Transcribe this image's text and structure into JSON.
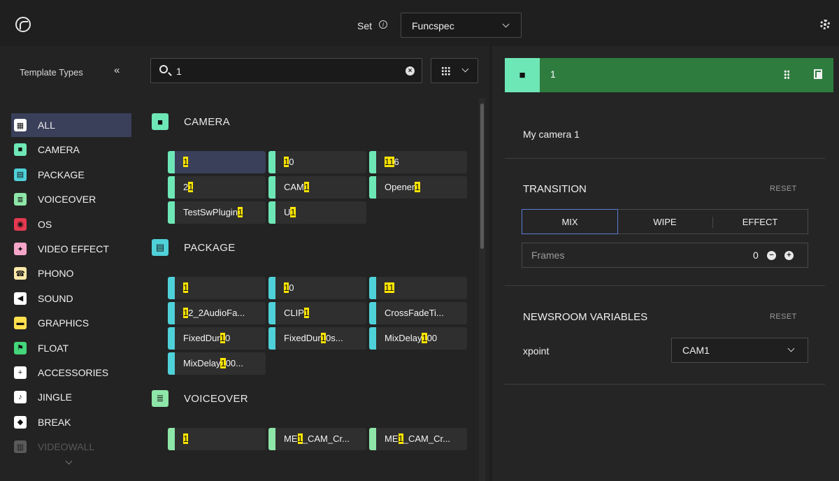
{
  "header": {
    "set_label": "Set",
    "set_value": "Funcspec"
  },
  "sidebar": {
    "title": "Template Types",
    "items": [
      {
        "label": "ALL",
        "icon": "grid-icon",
        "color": "#ffffff"
      },
      {
        "label": "CAMERA",
        "icon": "camera-icon",
        "color": "#6ee7b7"
      },
      {
        "label": "PACKAGE",
        "icon": "film-icon",
        "color": "#4fd1d9"
      },
      {
        "label": "VOICEOVER",
        "icon": "voiceover-icon",
        "color": "#8ee6a8"
      },
      {
        "label": "OS",
        "icon": "record-icon",
        "color": "#e53950"
      },
      {
        "label": "VIDEO EFFECT",
        "icon": "effect-icon",
        "color": "#f5a6c8"
      },
      {
        "label": "PHONO",
        "icon": "phone-icon",
        "color": "#ffe9a8"
      },
      {
        "label": "SOUND",
        "icon": "speaker-icon",
        "color": "#ffffff"
      },
      {
        "label": "GRAPHICS",
        "icon": "graphics-icon",
        "color": "#ffe14d"
      },
      {
        "label": "FLOAT",
        "icon": "flag-icon",
        "color": "#43d67a"
      },
      {
        "label": "ACCESSORIES",
        "icon": "plus-icon",
        "color": "#ffffff"
      },
      {
        "label": "JINGLE",
        "icon": "jingle-icon",
        "color": "#ffffff"
      },
      {
        "label": "BREAK",
        "icon": "break-icon",
        "color": "#ffffff"
      },
      {
        "label": "VIDEOWALL",
        "icon": "videowall-icon",
        "color": "#ffffff"
      }
    ]
  },
  "search": {
    "value": "1"
  },
  "sections": [
    {
      "label": "CAMERA",
      "color": "#6ee7b7",
      "cards": [
        [
          "",
          "1",
          ""
        ],
        [
          "",
          "1",
          "0"
        ],
        [
          "",
          "11",
          "6"
        ],
        [
          "2",
          "1",
          ""
        ],
        [
          "CAM",
          "1",
          ""
        ],
        [
          "Opener",
          "1",
          ""
        ],
        [
          "TestSwPlugin",
          "1",
          ""
        ],
        [
          "U",
          "1",
          ""
        ]
      ]
    },
    {
      "label": "PACKAGE",
      "color": "#4fd1d9",
      "cards": [
        [
          "",
          "1",
          ""
        ],
        [
          "",
          "1",
          "0"
        ],
        [
          "",
          "11",
          ""
        ],
        [
          "",
          "1",
          "2_2AudioFa..."
        ],
        [
          "CLIP",
          "1",
          ""
        ],
        [
          "CrossFadeTi...",
          "",
          ""
        ],
        [
          "FixedDur",
          "1",
          "0"
        ],
        [
          "FixedDur",
          "1",
          "0s..."
        ],
        [
          "MixDelay",
          "1",
          "00"
        ],
        [
          "MixDelay",
          "1",
          "00..."
        ]
      ]
    },
    {
      "label": "VOICEOVER",
      "color": "#8ee6a8",
      "cards": [
        [
          "",
          "1",
          ""
        ],
        [
          "ME",
          "1",
          "_CAM_Cr..."
        ],
        [
          "ME",
          "1",
          "_CAM_Cr..."
        ]
      ]
    }
  ],
  "detail": {
    "name": "1",
    "description": "My camera 1",
    "transition": {
      "title": "TRANSITION",
      "reset": "RESET",
      "options": [
        "MIX",
        "WIPE",
        "EFFECT"
      ],
      "selected": "MIX",
      "frames_label": "Frames",
      "frames_value": "0"
    },
    "newsroom": {
      "title": "NEWSROOM VARIABLES",
      "reset": "RESET",
      "xpoint_label": "xpoint",
      "xpoint_value": "CAM1"
    }
  },
  "colors": {
    "accent_green": "#2e7d3f",
    "selection": "#3a3f5a",
    "highlight": "#ffe600"
  }
}
